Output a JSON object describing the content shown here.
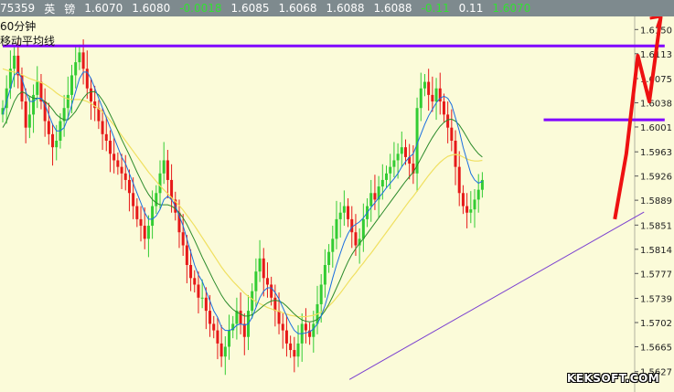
{
  "quote_bar": {
    "code": "75359",
    "name_char1": "英",
    "name_char2": "镑",
    "open": "1.6070",
    "high": "1.6080",
    "change": "-0.0018",
    "prev": "1.6085",
    "low": "1.6068",
    "last": "1.6088",
    "last2": "1.6088",
    "change_pct": "-0.11",
    "amplitude": "0.11",
    "current": "1.6070",
    "color_up": "#33e033",
    "color_text": "#ffffff",
    "color_bg": "#7e8a8e"
  },
  "chart_labels": {
    "period": "60分钟",
    "indicator": "移动平均线",
    "watermark": "KEKSOFT.COM"
  },
  "colors": {
    "background": "#fbfbd9",
    "axis_panel": "#fbfbd9",
    "candle_up": "#33cc33",
    "candle_down": "#e61919",
    "ma_short": "#1a6fe0",
    "ma_mid": "#2a8a2a",
    "ma_long": "#f0e060",
    "resistance_line": "#8000ff",
    "trend_line": "#7a3fd0",
    "arrow": "#ee1111"
  },
  "chart_data": {
    "type": "candlestick",
    "title": "",
    "ylim": [
      1.56,
      1.617
    ],
    "yticks": [
      "1.6150",
      "1.6113",
      "1.6075",
      "1.6038",
      "1.6001",
      "1.5963",
      "1.5926",
      "1.5889",
      "1.5851",
      "1.5814",
      "1.5777",
      "1.5739",
      "1.5702",
      "1.5665",
      "1.5627"
    ],
    "close_series": [
      1.603,
      1.606,
      1.609,
      1.611,
      1.608,
      1.604,
      1.6,
      1.602,
      1.605,
      1.607,
      1.604,
      1.601,
      1.599,
      1.597,
      1.598,
      1.601,
      1.603,
      1.605,
      1.608,
      1.61,
      1.6115,
      1.609,
      1.606,
      1.604,
      1.603,
      1.601,
      1.599,
      1.598,
      1.596,
      1.595,
      1.594,
      1.593,
      1.592,
      1.59,
      1.588,
      1.586,
      1.585,
      1.583,
      1.585,
      1.588,
      1.59,
      1.593,
      1.595,
      1.592,
      1.589,
      1.587,
      1.584,
      1.582,
      1.579,
      1.577,
      1.576,
      1.574,
      1.574,
      1.572,
      1.57,
      1.569,
      1.567,
      1.565,
      1.5665,
      1.569,
      1.57,
      1.572,
      1.57,
      1.568,
      1.572,
      1.575,
      1.578,
      1.58,
      1.577,
      1.576,
      1.574,
      1.572,
      1.57,
      1.569,
      1.567,
      1.566,
      1.565,
      1.567,
      1.57,
      1.569,
      1.568,
      1.57,
      1.573,
      1.576,
      1.579,
      1.581,
      1.583,
      1.586,
      1.587,
      1.588,
      1.586,
      1.584,
      1.582,
      1.583,
      1.586,
      1.588,
      1.59,
      1.589,
      1.591,
      1.592,
      1.593,
      1.594,
      1.595,
      1.596,
      1.597,
      1.5955,
      1.5945,
      1.593,
      1.603,
      1.606,
      1.607,
      1.605,
      1.604,
      1.606,
      1.604,
      1.602,
      1.6,
      1.598,
      1.594,
      1.59,
      1.588,
      1.587,
      1.5875,
      1.589,
      1.5905,
      1.592
    ],
    "ma_short": [
      1.602,
      1.604,
      1.606,
      1.608,
      1.6085,
      1.6075,
      1.6055,
      1.604,
      1.604,
      1.6045,
      1.6045,
      1.6035,
      1.602,
      1.6005,
      1.5995,
      1.5995,
      1.6,
      1.6015,
      1.6035,
      1.6055,
      1.6075,
      1.6085,
      1.6085,
      1.6075,
      1.606,
      1.6045,
      1.603,
      1.6015,
      1.6,
      1.5985,
      1.597,
      1.5955,
      1.5945,
      1.593,
      1.5915,
      1.59,
      1.5885,
      1.587,
      1.586,
      1.586,
      1.5865,
      1.5875,
      1.589,
      1.5895,
      1.589,
      1.588,
      1.5865,
      1.585,
      1.583,
      1.581,
      1.579,
      1.5775,
      1.5765,
      1.575,
      1.5735,
      1.572,
      1.571,
      1.5695,
      1.569,
      1.569,
      1.5692,
      1.5698,
      1.57,
      1.5698,
      1.57,
      1.571,
      1.5725,
      1.574,
      1.575,
      1.5755,
      1.5755,
      1.5748,
      1.5738,
      1.5725,
      1.5712,
      1.57,
      1.569,
      1.5685,
      1.5685,
      1.5686,
      1.5688,
      1.5692,
      1.57,
      1.5712,
      1.5728,
      1.5748,
      1.577,
      1.579,
      1.5808,
      1.5825,
      1.5838,
      1.5848,
      1.5852,
      1.5856,
      1.5862,
      1.587,
      1.5878,
      1.5885,
      1.5893,
      1.59,
      1.5908,
      1.5915,
      1.5922,
      1.593,
      1.594,
      1.5948,
      1.5955,
      1.596,
      1.5975,
      1.599,
      1.6005,
      1.6018,
      1.6028,
      1.6038,
      1.6045,
      1.6048,
      1.6045,
      1.6035,
      1.6015,
      1.5995,
      1.597,
      1.595,
      1.593,
      1.592,
      1.5915,
      1.5918
    ],
    "ma_mid": [
      1.6,
      1.601,
      1.6025,
      1.604,
      1.605,
      1.6055,
      1.6052,
      1.6048,
      1.6045,
      1.6045,
      1.6044,
      1.604,
      1.6035,
      1.6028,
      1.602,
      1.6015,
      1.6012,
      1.6012,
      1.6018,
      1.6025,
      1.6035,
      1.6045,
      1.6052,
      1.6055,
      1.6055,
      1.605,
      1.6042,
      1.6032,
      1.602,
      1.6008,
      1.5995,
      1.5982,
      1.597,
      1.5958,
      1.5945,
      1.5932,
      1.592,
      1.5908,
      1.5898,
      1.589,
      1.5885,
      1.5882,
      1.5882,
      1.5882,
      1.588,
      1.5876,
      1.587,
      1.5862,
      1.5852,
      1.584,
      1.5828,
      1.5815,
      1.5802,
      1.579,
      1.5778,
      1.5766,
      1.5755,
      1.5744,
      1.5735,
      1.5728,
      1.5722,
      1.5718,
      1.5715,
      1.5712,
      1.5712,
      1.5714,
      1.5718,
      1.5723,
      1.5728,
      1.5732,
      1.5735,
      1.5736,
      1.5735,
      1.5732,
      1.5727,
      1.5721,
      1.5715,
      1.571,
      1.5706,
      1.5704,
      1.5703,
      1.5704,
      1.5707,
      1.5712,
      1.572,
      1.573,
      1.5742,
      1.5755,
      1.5768,
      1.5782,
      1.5795,
      1.5806,
      1.5815,
      1.5823,
      1.583,
      1.5838,
      1.5846,
      1.5854,
      1.5862,
      1.587,
      1.5878,
      1.5886,
      1.5894,
      1.5902,
      1.591,
      1.5918,
      1.5925,
      1.5932,
      1.5942,
      1.5953,
      1.5964,
      1.5975,
      1.5985,
      1.5994,
      1.6002,
      1.6008,
      1.6012,
      1.6013,
      1.601,
      1.6004,
      1.5995,
      1.5985,
      1.5975,
      1.5967,
      1.596,
      1.5955
    ],
    "ma_long": [
      1.609,
      1.6088,
      1.6086,
      1.6085,
      1.6083,
      1.6081,
      1.6078,
      1.6075,
      1.6073,
      1.6071,
      1.6069,
      1.6066,
      1.6062,
      1.6058,
      1.6053,
      1.6049,
      1.6046,
      1.6044,
      1.6043,
      1.6043,
      1.6043,
      1.6042,
      1.604,
      1.6037,
      1.6033,
      1.6029,
      1.6024,
      1.6018,
      1.6011,
      1.6004,
      1.5996,
      1.5988,
      1.598,
      1.5972,
      1.5964,
      1.5956,
      1.5948,
      1.594,
      1.5932,
      1.5925,
      1.5918,
      1.5911,
      1.5905,
      1.5899,
      1.5893,
      1.5887,
      1.5881,
      1.5874,
      1.5866,
      1.5858,
      1.585,
      1.5841,
      1.5832,
      1.5823,
      1.5814,
      1.5805,
      1.5796,
      1.5787,
      1.5779,
      1.5772,
      1.5765,
      1.5759,
      1.5753,
      1.5747,
      1.5742,
      1.5738,
      1.5734,
      1.5731,
      1.5728,
      1.5725,
      1.5723,
      1.5721,
      1.5719,
      1.5717,
      1.5715,
      1.5713,
      1.5712,
      1.5711,
      1.5711,
      1.5711,
      1.5712,
      1.5713,
      1.5715,
      1.5718,
      1.5722,
      1.5727,
      1.5733,
      1.574,
      1.5747,
      1.5755,
      1.5763,
      1.5771,
      1.5778,
      1.5786,
      1.5793,
      1.5801,
      1.5808,
      1.5816,
      1.5824,
      1.5832,
      1.584,
      1.5848,
      1.5856,
      1.5864,
      1.5872,
      1.588,
      1.5888,
      1.5895,
      1.5903,
      1.5911,
      1.5919,
      1.5927,
      1.5934,
      1.5941,
      1.5947,
      1.5952,
      1.5956,
      1.5958,
      1.5959,
      1.5958,
      1.5955,
      1.5952,
      1.595,
      1.5949,
      1.5949,
      1.595
    ],
    "resistance_lines": [
      {
        "y": 1.6125,
        "from_index": 0,
        "to_index": 163
      },
      {
        "y": 1.6012,
        "from_index": 141,
        "to_index": 163
      }
    ],
    "trend_line": {
      "start": {
        "index": 57,
        "y": 1.5615
      },
      "end": {
        "index": 160,
        "y": 1.5871
      }
    },
    "arrow_path": [
      [
        1.586,
        150
      ],
      [
        1.596,
        153
      ],
      [
        1.611,
        156
      ],
      [
        1.604,
        159
      ],
      [
        1.617,
        162
      ]
    ]
  }
}
